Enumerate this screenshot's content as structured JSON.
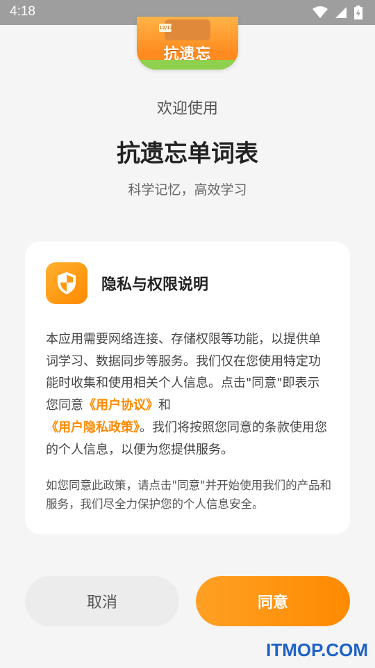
{
  "status_bar": {
    "time": "4:18"
  },
  "app_logo": {
    "text": "抗遗忘",
    "tag": "12/12"
  },
  "header": {
    "welcome": "欢迎使用",
    "title": "抗遗忘单词表",
    "subtitle": "科学记忆，高效学习"
  },
  "card": {
    "title": "隐私与权限说明",
    "body_part1": "本应用需要网络连接、存储权限等功能，以提供单词学习、数据同步等服务。我们仅在您使用特定功能时收集和使用相关个人信息。点击\"同意\"即表示您同意",
    "user_agreement_link": "《用户协议》",
    "body_and": "和",
    "privacy_link": "《用户隐私政策》",
    "body_part2": "。我们将按照您同意的条款使用您的个人信息，以便为您提供服务。",
    "note": "如您同意此政策，请点击\"同意\"并开始使用我们的产品和服务，我们尽全力保护您的个人信息安全。"
  },
  "buttons": {
    "cancel": "取消",
    "agree": "同意"
  },
  "watermark": "ITMOP.COM",
  "colors": {
    "accent": "#ff8a00",
    "background": "#f5f5f5",
    "status_bar": "#9e9e9e"
  },
  "icons": [
    "wifi-icon",
    "cellular-signal-icon",
    "battery-icon",
    "shield-icon"
  ]
}
